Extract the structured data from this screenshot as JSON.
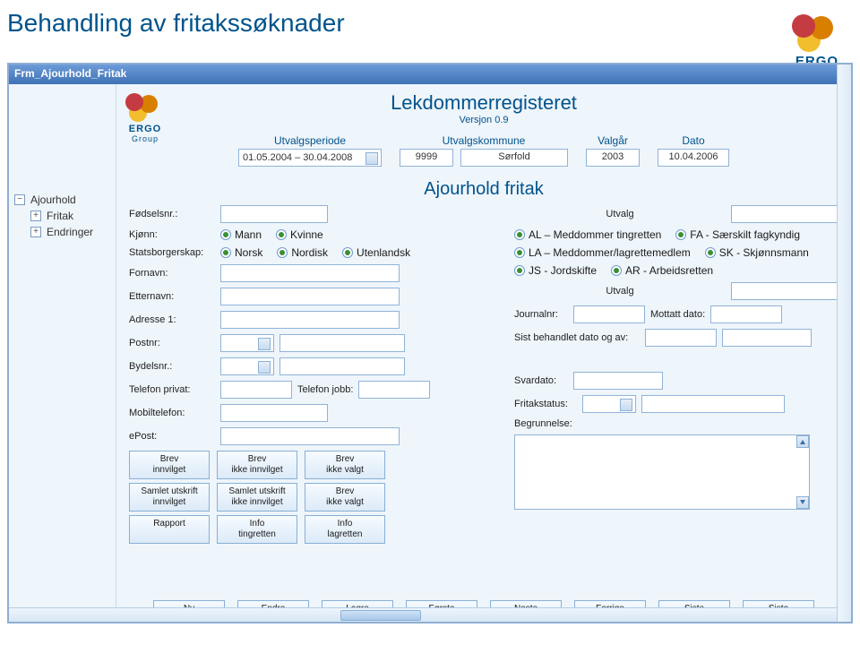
{
  "page_title": "Behandling av fritakssøknader",
  "brand": {
    "name": "ERGO",
    "sub": "Group"
  },
  "window": {
    "title": "Frm_Ajourhold_Fritak"
  },
  "app": {
    "name": "Lekdommerregisteret",
    "version": "Versjon 0.9"
  },
  "header": {
    "utvalgsperiode_lbl": "Utvalgsperiode",
    "utvalgsperiode_val": "01.05.2004 – 30.04.2008",
    "utvalgskommune_lbl": "Utvalgskommune",
    "utvalgskommune_code": "9999",
    "utvalgskommune_name": "Sørfold",
    "valgaar_lbl": "Valgår",
    "valgaar_val": "2003",
    "dato_lbl": "Dato",
    "dato_val": "10.04.2006"
  },
  "tree": {
    "root": "Ajourhold",
    "item1": "Fritak",
    "item2": "Endringer"
  },
  "section_title": "Ajourhold fritak",
  "form": {
    "fodselsnr_lbl": "Fødselsnr.:",
    "utvalg_lbl": "Utvalg",
    "kjonn_lbl": "Kjønn:",
    "kjonn_opt1": "Mann",
    "kjonn_opt2": "Kvinne",
    "statsb_lbl": "Statsborgerskap:",
    "statsb_opt1": "Norsk",
    "statsb_opt2": "Nordisk",
    "statsb_opt3": "Utenlandsk",
    "fornavn_lbl": "Fornavn:",
    "etternavn_lbl": "Etternavn:",
    "adresse1_lbl": "Adresse 1:",
    "postnr_lbl": "Postnr:",
    "bydelsnr_lbl": "Bydelsnr.:",
    "tlfpriv_lbl": "Telefon privat:",
    "tlfjobb_lbl": "Telefon jobb:",
    "mobil_lbl": "Mobiltelefon:",
    "epost_lbl": "ePost:",
    "utvalg_opts": {
      "al": "AL – Meddommer tingretten",
      "la": "LA – Meddommer/lagrettemedlem",
      "js": "JS - Jordskifte",
      "fa": "FA - Særskilt fagkyndig",
      "sk": "SK - Skjønnsmann",
      "ar": "AR - Arbeidsretten"
    },
    "utvalg2_lbl": "Utvalg",
    "journalnr_lbl": "Journalnr:",
    "mottatt_lbl": "Mottatt dato:",
    "sistbeh_lbl": "Sist behandlet dato og av:",
    "svardato_lbl": "Svardato:",
    "fritakstatus_lbl": "Fritakstatus:",
    "begrunnelse_lbl": "Begrunnelse:"
  },
  "buttons": {
    "brev_innv": "Brev\ninnvilget",
    "brev_ikkeinnv": "Brev\nikke innvilget",
    "brev_ikkevalgt": "Brev\nikke valgt",
    "saml_innv": "Samlet utskrift\ninnvilget",
    "saml_ikkeinnv": "Samlet utskrift\nikke innvilget",
    "brev_ikkevalgt2": "Brev\nikke valgt",
    "rapport": "Rapport",
    "info_ting": "Info\ntingretten",
    "info_lag": "Info\nlagretten"
  },
  "nav": {
    "ny": "Ny",
    "endre": "Endre",
    "lagre": "Lagre",
    "forste": "Første",
    "neste": "Neste",
    "forrige": "Forrige",
    "siste1": "Siste",
    "siste2": "Siste"
  }
}
